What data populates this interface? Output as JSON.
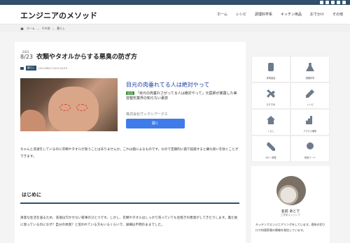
{
  "site": {
    "title": "エンジニアのメソッド"
  },
  "topbar": {
    "icons": [
      "twitter-icon",
      "facebook-icon",
      "hatena-icon",
      "mail-icon",
      "rss-icon"
    ]
  },
  "nav": {
    "items": [
      "ホーム",
      "レシピ",
      "調理科学系",
      "キッチン用品",
      "おでかけ",
      "その他"
    ]
  },
  "breadcrumb": {
    "items": [
      "ホーム",
      "その他",
      "暮らし"
    ]
  },
  "post": {
    "date_year": "2021",
    "date_md": "8/23",
    "title": "衣類やタオルからする悪臭の防ぎ方",
    "category": "暮らし",
    "dates": "2021/08/23  2021/10/19",
    "intro": "ちゃんと洗濯をしているのに衣類やタオルが臭うことはありませんか。これは菌によるものです。なので定期的に菌で殺菌すると嫌な臭いを防ぐことができます。",
    "heading": "はじめに",
    "paragraph": "清潔な生活を送るため、洗濯は欠かせない家事のひとつです。しかし、衣類やタオルはしっかり洗っていても生乾きの悪臭がしてきたりします。着た後に臭っているのになぜ？自分の体臭？と思われている方もいるくらいで、詳細は不明のままでした。"
  },
  "ad": {
    "title": "目元の肉垂れてる人は絶対やって",
    "tag": "広告",
    "description": "「目元の肉垂れさがってる人は絶対やって」元医師が暴露した美容整形業界の知らない裏技",
    "sponsor": "株式会社ヴィクシアークス",
    "button": "開く"
  },
  "sidebar": {
    "grid": [
      {
        "label": "家電製品",
        "icon": "mobile-icon"
      },
      {
        "label": "調理科学",
        "icon": "flask-icon"
      },
      {
        "label": "おすすめ",
        "icon": "wrench-icon"
      },
      {
        "label": "レシピ",
        "icon": "pencil-icon"
      },
      {
        "label": "くらし",
        "icon": "house-icon"
      },
      {
        "label": "アクセス解析",
        "icon": "chart-icon"
      },
      {
        "label": "DIY・修理",
        "icon": "tools-icon"
      },
      {
        "label": "検索ワード",
        "icon": "search-icon"
      }
    ],
    "profile": {
      "name": "名前 あとで",
      "role": "工学系エンジニア",
      "description": "キッチンでエンジニアリングをしています。理系の切り口で料理家電の情報を発信しています。"
    }
  }
}
